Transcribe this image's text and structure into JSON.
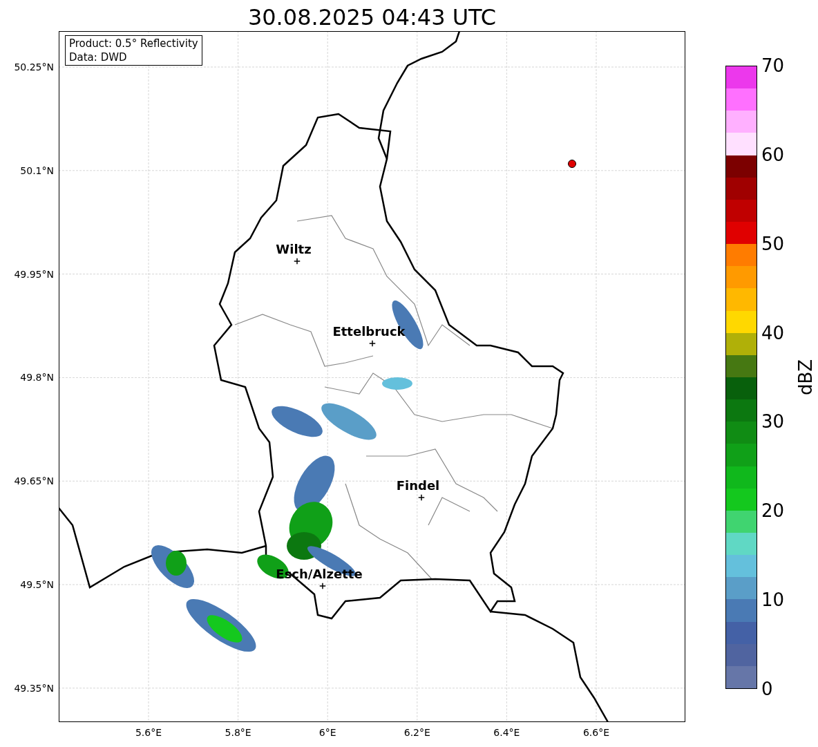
{
  "title": "30.08.2025 04:43 UTC",
  "map": {
    "info_box": [
      "Product: 0.5° Reflectivity",
      "Data: DWD"
    ],
    "xticks": [
      "5.6°E",
      "5.8°E",
      "6°E",
      "6.2°E",
      "6.4°E",
      "6.6°E"
    ],
    "yticks": [
      "50.25°N",
      "50.1°N",
      "49.95°N",
      "49.8°N",
      "49.65°N",
      "49.5°N",
      "49.35°N"
    ],
    "cities": [
      {
        "name": "Wiltz"
      },
      {
        "name": "Ettelbruck"
      },
      {
        "name": "Findel"
      },
      {
        "name": "Esch/Alzette"
      }
    ]
  },
  "colorbar": {
    "label": "dBZ",
    "ticks": [
      "70",
      "60",
      "50",
      "40",
      "30",
      "20",
      "10",
      "0"
    ],
    "bins": [
      {
        "color": "#6676a8"
      },
      {
        "color": "#5064a0"
      },
      {
        "color": "#4461a6"
      },
      {
        "color": "#4a7ab4"
      },
      {
        "color": "#5a9ec8"
      },
      {
        "color": "#64c0dc"
      },
      {
        "color": "#60d8c4"
      },
      {
        "color": "#40d470"
      },
      {
        "color": "#14c81e"
      },
      {
        "color": "#10b81c"
      },
      {
        "color": "#10a018"
      },
      {
        "color": "#108c14"
      },
      {
        "color": "#0c7810"
      },
      {
        "color": "#08600c"
      },
      {
        "color": "#467812"
      },
      {
        "color": "#b0b008"
      },
      {
        "color": "#ffd800"
      },
      {
        "color": "#ffb800"
      },
      {
        "color": "#ff9a00"
      },
      {
        "color": "#ff7c00"
      },
      {
        "color": "#e00000"
      },
      {
        "color": "#c00000"
      },
      {
        "color": "#a00000"
      },
      {
        "color": "#7c0000"
      },
      {
        "color": "#ffe0ff"
      },
      {
        "color": "#ffb0ff"
      },
      {
        "color": "#ff70ff"
      },
      {
        "color": "#ec38ec"
      }
    ]
  }
}
